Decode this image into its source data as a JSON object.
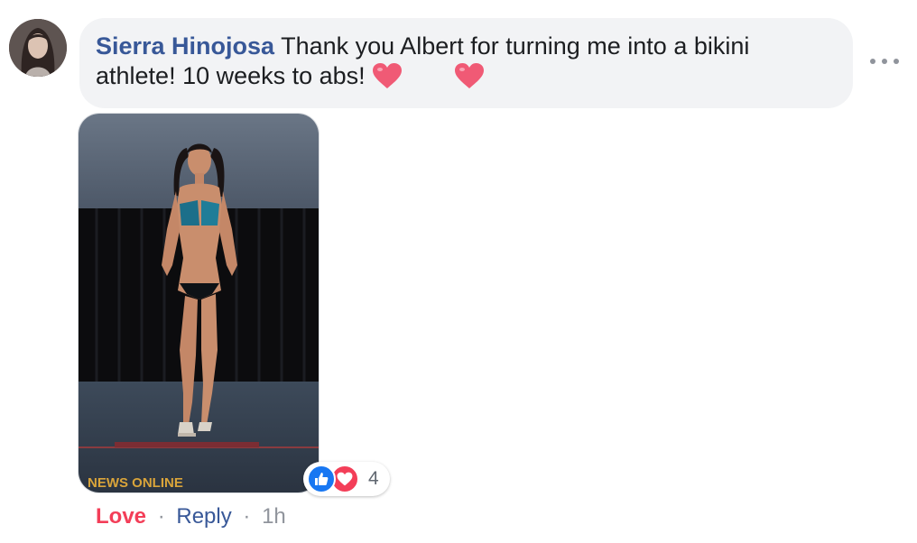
{
  "comment": {
    "author": "Sierra Hinojosa",
    "text": "Thank you Albert for turning me into a bikini athlete! 10 weeks to abs!",
    "emoji": [
      "heart-emoji",
      "heart-emoji"
    ]
  },
  "photo": {
    "watermark": "NEWS ONLINE"
  },
  "reactions": {
    "types": [
      "like",
      "love"
    ],
    "count": "4"
  },
  "actions": {
    "love_label": "Love",
    "separator": "·",
    "reply_label": "Reply",
    "time": "1h"
  },
  "colors": {
    "author": "#385898",
    "bubble": "#f2f3f5",
    "love": "#f33e58",
    "like": "#1877f2",
    "meta": "#90949c"
  }
}
